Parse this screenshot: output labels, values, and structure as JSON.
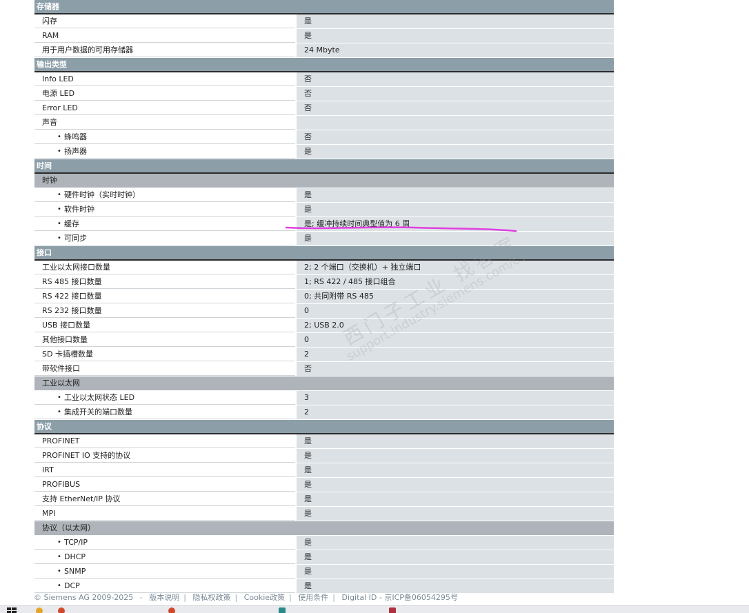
{
  "sections": [
    {
      "type": "section",
      "label": "存储器"
    },
    {
      "type": "row",
      "label": "闪存",
      "value": "是"
    },
    {
      "type": "row",
      "label": "RAM",
      "value": "是"
    },
    {
      "type": "row",
      "label": "用于用户数据的可用存储器",
      "value": "24 Mbyte"
    },
    {
      "type": "section",
      "label": "输出类型"
    },
    {
      "type": "row",
      "label": "Info LED",
      "value": "否"
    },
    {
      "type": "row",
      "label": "电源 LED",
      "value": "否"
    },
    {
      "type": "row",
      "label": "Error LED",
      "value": "否"
    },
    {
      "type": "row",
      "label": "声音",
      "value": ""
    },
    {
      "type": "bullet",
      "label": "蜂鸣器",
      "value": "否"
    },
    {
      "type": "bullet",
      "label": "扬声器",
      "value": "是"
    },
    {
      "type": "section",
      "label": "时间"
    },
    {
      "type": "sub",
      "label": "时钟"
    },
    {
      "type": "bullet",
      "label": "硬件时钟（实时时钟）",
      "value": "是"
    },
    {
      "type": "bullet",
      "label": "软件时钟",
      "value": "是"
    },
    {
      "type": "bullet",
      "label": "缓存",
      "value": "是; 缓冲持续时间典型值为 6 周"
    },
    {
      "type": "bullet",
      "label": "可同步",
      "value": "是"
    },
    {
      "type": "section",
      "label": "接口"
    },
    {
      "type": "row",
      "label": "工业以太网接口数量",
      "value": "2; 2 个端口（交换机）+ 独立端口"
    },
    {
      "type": "row",
      "label": "RS 485 接口数量",
      "value": "1; RS 422 / 485 接口组合"
    },
    {
      "type": "row",
      "label": "RS 422 接口数量",
      "value": "0; 共同附带 RS 485"
    },
    {
      "type": "row",
      "label": "RS 232 接口数量",
      "value": "0"
    },
    {
      "type": "row",
      "label": "USB 接口数量",
      "value": "2; USB 2.0"
    },
    {
      "type": "row",
      "label": "其他接口数量",
      "value": "0"
    },
    {
      "type": "row",
      "label": "SD 卡插槽数量",
      "value": "2"
    },
    {
      "type": "row",
      "label": "带软件接口",
      "value": "否"
    },
    {
      "type": "sub",
      "label": "工业以太网"
    },
    {
      "type": "bullet",
      "label": "工业以太网状态 LED",
      "value": "3"
    },
    {
      "type": "bullet",
      "label": "集成开关的端口数量",
      "value": "2"
    },
    {
      "type": "section",
      "label": "协议"
    },
    {
      "type": "row",
      "label": "PROFINET",
      "value": "是"
    },
    {
      "type": "row",
      "label": "PROFINET IO 支持的协议",
      "value": "是"
    },
    {
      "type": "row",
      "label": "IRT",
      "value": "是"
    },
    {
      "type": "row",
      "label": "PROFIBUS",
      "value": "是"
    },
    {
      "type": "row",
      "label": "支持 EtherNet/IP 协议",
      "value": "是"
    },
    {
      "type": "row",
      "label": "MPI",
      "value": "是"
    },
    {
      "type": "sub",
      "label": "协议（以太网）"
    },
    {
      "type": "bullet",
      "label": "TCP/IP",
      "value": "是"
    },
    {
      "type": "bullet",
      "label": "DHCP",
      "value": "是"
    },
    {
      "type": "bullet",
      "label": "SNMP",
      "value": "是"
    },
    {
      "type": "bullet",
      "label": "DCP",
      "value": "是"
    }
  ],
  "footer": {
    "copyright": "© Siemens AG 2009-2025",
    "dash": "-",
    "links": [
      "版本说明",
      "隐私权政策",
      "Cookie政策",
      "使用条件",
      "Digital ID - 京ICP备06054295号"
    ]
  },
  "watermark": {
    "line1": "西门子工业 找答案",
    "line2": "support.industry.siemens.com/cs"
  },
  "highlight_color": "#e040e0"
}
